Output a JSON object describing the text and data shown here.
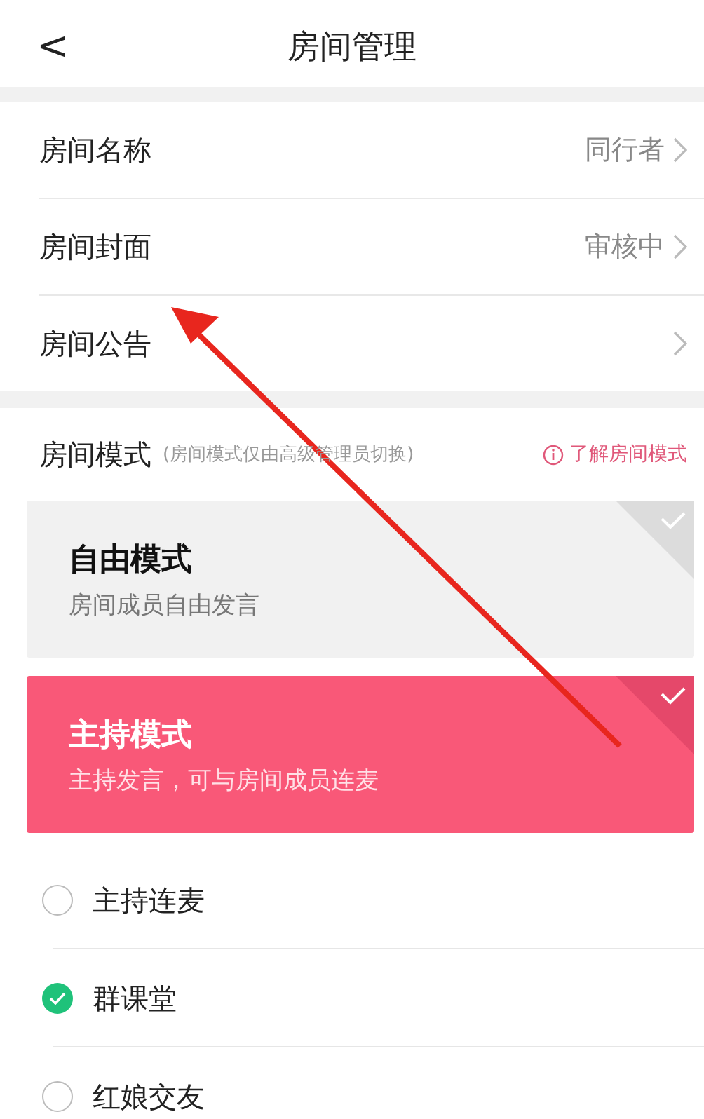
{
  "nav": {
    "back": "<",
    "title": "房间管理"
  },
  "settings": [
    {
      "label": "房间名称",
      "value": "同行者"
    },
    {
      "label": "房间封面",
      "value": "审核中"
    },
    {
      "label": "房间公告"
    }
  ],
  "mode_section": {
    "title": "房间模式",
    "note": "(房间模式仅由高级管理员切换)",
    "help_link": "了解房间模式"
  },
  "modes": [
    {
      "name": "自由模式",
      "description": "房间成员自由发言",
      "selected": false
    },
    {
      "name": "主持模式",
      "description": "主持发言，可与房间成员连麦",
      "selected": true
    }
  ],
  "sub_options": [
    {
      "label": "主持连麦",
      "selected": false
    },
    {
      "label": "群课堂",
      "selected": true
    },
    {
      "label": "红娘交友",
      "selected": false
    }
  ],
  "annotation": {
    "kind": "arrow"
  }
}
